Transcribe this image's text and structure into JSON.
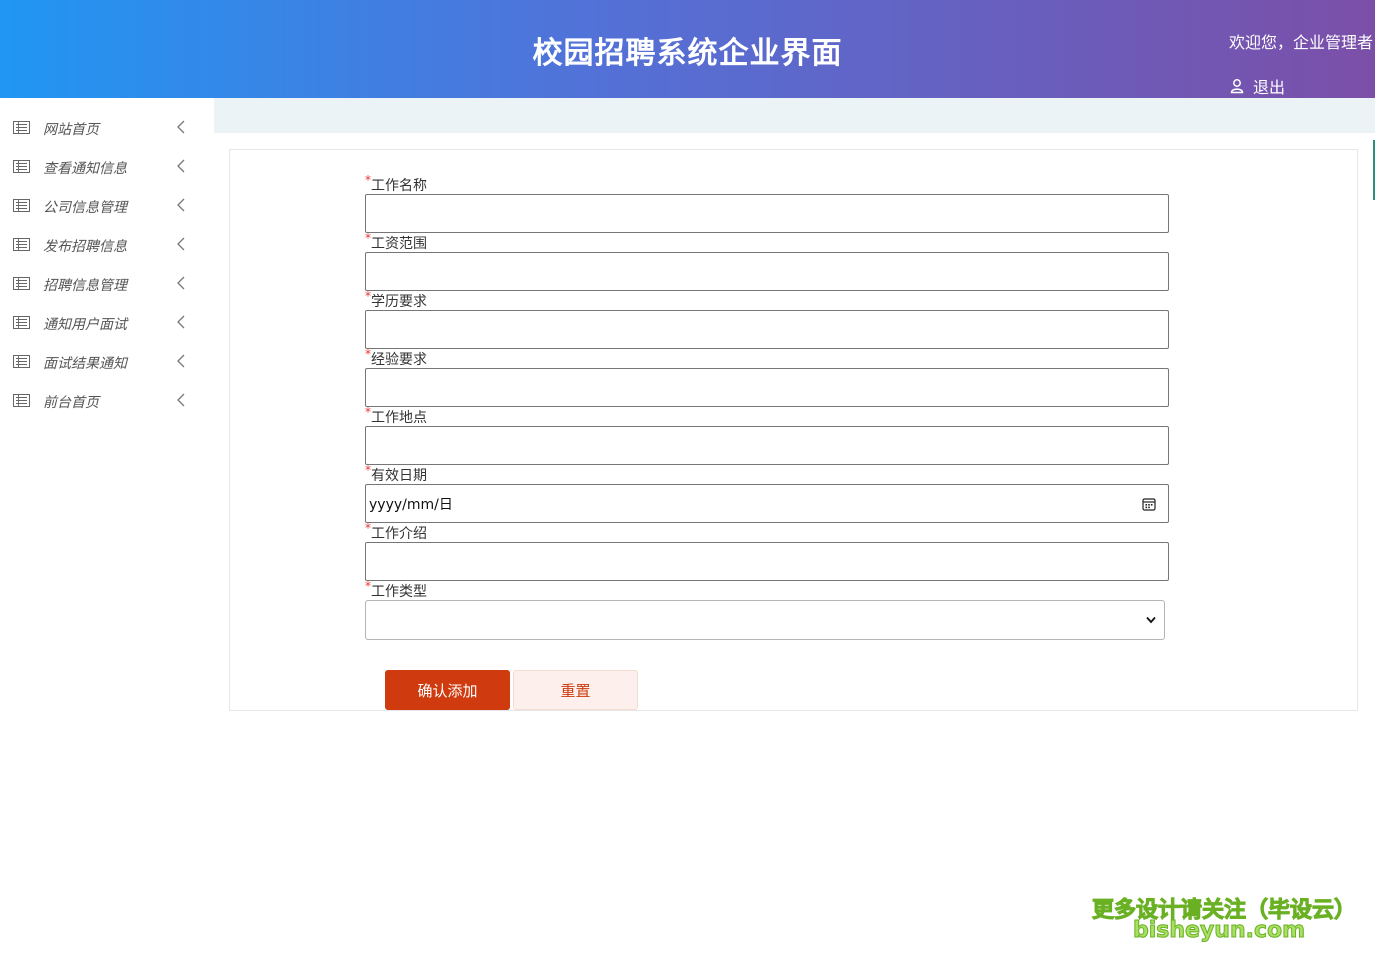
{
  "header": {
    "title": "校园招聘系统企业界面",
    "welcome": "欢迎您，企业管理者",
    "logout_label": "退出"
  },
  "sidebar": {
    "items": [
      {
        "label": "网站首页"
      },
      {
        "label": "查看通知信息"
      },
      {
        "label": "公司信息管理"
      },
      {
        "label": "发布招聘信息"
      },
      {
        "label": "招聘信息管理"
      },
      {
        "label": "通知用户面试"
      },
      {
        "label": "面试结果通知"
      },
      {
        "label": "前台首页"
      }
    ]
  },
  "form": {
    "required_mark": "*",
    "fields": [
      {
        "label": "工作名称",
        "value": ""
      },
      {
        "label": "工资范围",
        "value": ""
      },
      {
        "label": "学历要求",
        "value": ""
      },
      {
        "label": "经验要求",
        "value": ""
      },
      {
        "label": "工作地点",
        "value": ""
      },
      {
        "label": "有效日期",
        "value": "yyyy/mm/日"
      },
      {
        "label": "工作介绍",
        "value": ""
      },
      {
        "label": "工作类型",
        "value": ""
      }
    ],
    "submit_label": "确认添加",
    "reset_label": "重置"
  },
  "watermark": {
    "line1": "更多设计请关注（毕设云）",
    "line2": "bisheyun.com"
  },
  "colors": {
    "header_gradient_start": "#2196f3",
    "header_gradient_end": "#7b4fa8",
    "primary_button": "#cf3a0f",
    "required_mark": "#ee3333"
  }
}
